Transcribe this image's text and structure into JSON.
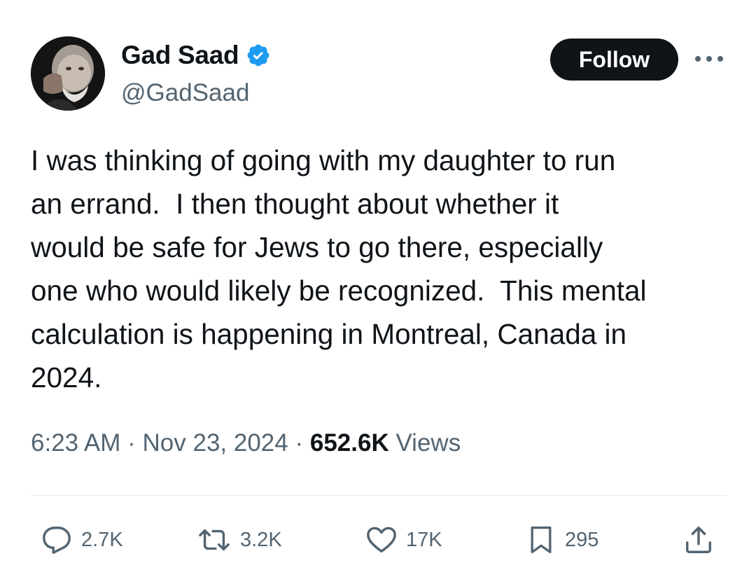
{
  "author": {
    "display_name": "Gad Saad",
    "handle": "@GadSaad",
    "verified": true
  },
  "header": {
    "follow_label": "Follow",
    "more_label": "···"
  },
  "tweet": {
    "text": "I was thinking of going with my daughter to run\nan errand.  I then thought about whether it\nwould be safe for Jews to go there, especially\none who would likely be recognized.  This mental\ncalculation is happening in Montreal, Canada in\n2024."
  },
  "meta": {
    "time": "6:23 AM",
    "separator": " · ",
    "date": "Nov 23, 2024",
    "views_count": "652.6K",
    "views_label": " Views"
  },
  "actions": {
    "replies": "2.7K",
    "reposts": "3.2K",
    "likes": "17K",
    "bookmarks": "295"
  },
  "colors": {
    "text": "#0f1419",
    "secondary": "#536471",
    "verified_blue": "#1d9bf0",
    "follow_bg": "#0f1419",
    "divider": "#e6e8ea"
  }
}
